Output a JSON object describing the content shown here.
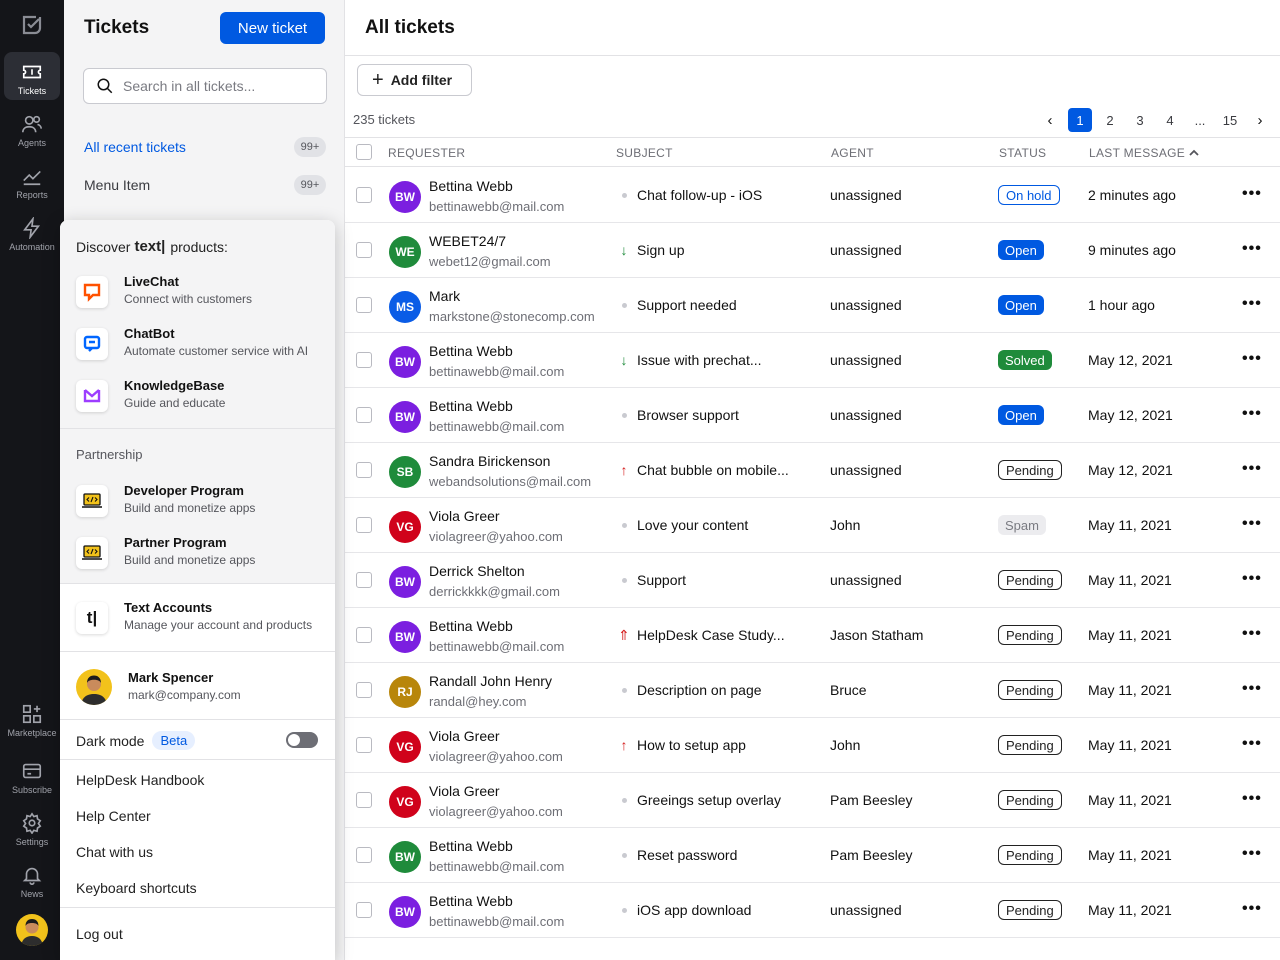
{
  "rail": {
    "items": [
      {
        "label": "Tickets",
        "icon": "ticket-icon",
        "active": true
      },
      {
        "label": "Agents",
        "icon": "agents-icon"
      },
      {
        "label": "Reports",
        "icon": "reports-icon"
      },
      {
        "label": "Automation",
        "icon": "lightning-icon"
      },
      {
        "label": "Marketplace",
        "icon": "grid-plus-icon"
      },
      {
        "label": "Subscribe",
        "icon": "card-icon"
      },
      {
        "label": "Settings",
        "icon": "gear-icon"
      },
      {
        "label": "News",
        "icon": "bell-icon"
      }
    ]
  },
  "sidebar": {
    "title": "Tickets",
    "new_ticket_label": "New ticket",
    "search_placeholder": "Search in all tickets...",
    "links": [
      {
        "label": "All recent tickets",
        "count": "99+",
        "active": true
      },
      {
        "label": "Menu Item",
        "count": "99+"
      }
    ]
  },
  "main": {
    "title": "All tickets",
    "add_filter_label": "Add filter",
    "ticket_count": "235 tickets",
    "pagination": {
      "pages": [
        "1",
        "2",
        "3",
        "4",
        "...",
        "15"
      ],
      "current": "1",
      "prev": "‹",
      "next": "›"
    },
    "columns": {
      "requester": "REQUESTER",
      "subject": "SUBJECT",
      "agent": "AGENT",
      "status": "STATUS",
      "last_message": "LAST MESSAGE",
      "sort_indicator": "^"
    },
    "rows": [
      {
        "initials": "BW",
        "color": "#7b1fe0",
        "name": "Bettina Webb",
        "email": "bettinawebb@mail.com",
        "priority": "normal",
        "priority_glyph": "",
        "subject": "Chat follow-up - iOS",
        "agent": "unassigned",
        "status": "On hold",
        "status_type": "onhold",
        "last": "2 minutes ago"
      },
      {
        "initials": "WE",
        "color": "#1f8b3b",
        "name": "WEBET24/7",
        "email": "webet12@gmail.com",
        "priority": "low",
        "priority_glyph": "↓",
        "subject": "Sign up",
        "agent": "unassigned",
        "status": "Open",
        "status_type": "open",
        "last": "9 minutes ago"
      },
      {
        "initials": "MS",
        "color": "#0a5ce6",
        "name": "Mark",
        "email": "markstone@stonecomp.com",
        "priority": "normal",
        "priority_glyph": "",
        "subject": "Support needed",
        "agent": "unassigned",
        "status": "Open",
        "status_type": "open",
        "last": "1 hour ago"
      },
      {
        "initials": "BW",
        "color": "#7b1fe0",
        "name": "Bettina Webb",
        "email": "bettinawebb@mail.com",
        "priority": "low",
        "priority_glyph": "↓",
        "subject": "Issue with prechat...",
        "agent": "unassigned",
        "status": "Solved",
        "status_type": "solved",
        "last": "May 12, 2021"
      },
      {
        "initials": "BW",
        "color": "#7b1fe0",
        "name": "Bettina Webb",
        "email": "bettinawebb@mail.com",
        "priority": "normal",
        "priority_glyph": "",
        "subject": "Browser support",
        "agent": "unassigned",
        "status": "Open",
        "status_type": "open",
        "last": "May 12, 2021"
      },
      {
        "initials": "SB",
        "color": "#1f8b3b",
        "name": "Sandra Birickenson",
        "email": "webandsolutions@mail.com",
        "priority": "high",
        "priority_glyph": "↑",
        "subject": "Chat bubble on mobile...",
        "agent": "unassigned",
        "status": "Pending",
        "status_type": "pending",
        "last": "May 12, 2021"
      },
      {
        "initials": "VG",
        "color": "#d0021b",
        "name": "Viola Greer",
        "email": "violagreer@yahoo.com",
        "priority": "normal",
        "priority_glyph": "",
        "subject": "Love your content",
        "agent": "John",
        "status": "Spam",
        "status_type": "spam",
        "last": "May 11, 2021"
      },
      {
        "initials": "BW",
        "color": "#7b1fe0",
        "name": "Derrick Shelton",
        "email": "derrickkkk@gmail.com",
        "priority": "normal",
        "priority_glyph": "",
        "subject": "Support",
        "agent": "unassigned",
        "status": "Pending",
        "status_type": "pending",
        "last": "May 11, 2021"
      },
      {
        "initials": "BW",
        "color": "#7b1fe0",
        "name": "Bettina Webb",
        "email": "bettinawebb@mail.com",
        "priority": "high",
        "priority_glyph": "⇑",
        "subject": "HelpDesk Case Study...",
        "agent": "Jason Statham",
        "status": "Pending",
        "status_type": "pending",
        "last": "May 11, 2021"
      },
      {
        "initials": "RJ",
        "color": "#b8860b",
        "name": "Randall John Henry",
        "email": "randal@hey.com",
        "priority": "normal",
        "priority_glyph": "",
        "subject": "Description on page",
        "agent": "Bruce",
        "status": "Pending",
        "status_type": "pending",
        "last": "May 11, 2021"
      },
      {
        "initials": "VG",
        "color": "#d0021b",
        "name": "Viola Greer",
        "email": "violagreer@yahoo.com",
        "priority": "high",
        "priority_glyph": "↑",
        "subject": "How to setup app",
        "agent": "John",
        "status": "Pending",
        "status_type": "pending",
        "last": "May 11, 2021"
      },
      {
        "initials": "VG",
        "color": "#d0021b",
        "name": "Viola Greer",
        "email": "violagreer@yahoo.com",
        "priority": "normal",
        "priority_glyph": "",
        "subject": "Greeings setup overlay",
        "agent": "Pam Beesley",
        "status": "Pending",
        "status_type": "pending",
        "last": "May 11, 2021"
      },
      {
        "initials": "BW",
        "color": "#1f8b3b",
        "name": "Bettina Webb",
        "email": "bettinawebb@mail.com",
        "priority": "normal",
        "priority_glyph": "",
        "subject": "Reset password",
        "agent": "Pam Beesley",
        "status": "Pending",
        "status_type": "pending",
        "last": "May 11, 2021"
      },
      {
        "initials": "BW",
        "color": "#7b1fe0",
        "name": "Bettina Webb",
        "email": "bettinawebb@mail.com",
        "priority": "normal",
        "priority_glyph": "",
        "subject": "iOS app download",
        "agent": "unassigned",
        "status": "Pending",
        "status_type": "pending",
        "last": "May 11, 2021"
      }
    ]
  },
  "popup": {
    "discover_prefix": "Discover",
    "discover_brand": "text|",
    "discover_suffix": "products:",
    "products": [
      {
        "name": "LiveChat",
        "desc": "Connect with customers",
        "icon": "livechat-icon",
        "color": "#ff5100"
      },
      {
        "name": "ChatBot",
        "desc": "Automate customer service with AI",
        "icon": "chatbot-icon",
        "color": "#0066ff"
      },
      {
        "name": "KnowledgeBase",
        "desc": "Guide and educate",
        "icon": "knowledgebase-icon",
        "color": "#9d3dff"
      }
    ],
    "partnership_label": "Partnership",
    "partners": [
      {
        "name": "Developer Program",
        "desc": "Build and monetize apps",
        "icon": "code-laptop-icon"
      },
      {
        "name": "Partner Program",
        "desc": "Build and monetize apps",
        "icon": "code-laptop-icon"
      }
    ],
    "accounts": {
      "name": "Text Accounts",
      "desc": "Manage your account and products",
      "glyph": "t|"
    },
    "user": {
      "name": "Mark Spencer",
      "email": "mark@company.com"
    },
    "dark_mode_label": "Dark mode",
    "beta_label": "Beta",
    "dark_mode_on": false,
    "links": [
      "HelpDesk Handbook",
      "Help Center",
      "Chat with us",
      "Keyboard shortcuts"
    ],
    "logout_label": "Log out"
  },
  "colors": {
    "accent": "#0059e1",
    "rail_bg": "#141519",
    "sidebar_bg": "#f4f4f5"
  }
}
